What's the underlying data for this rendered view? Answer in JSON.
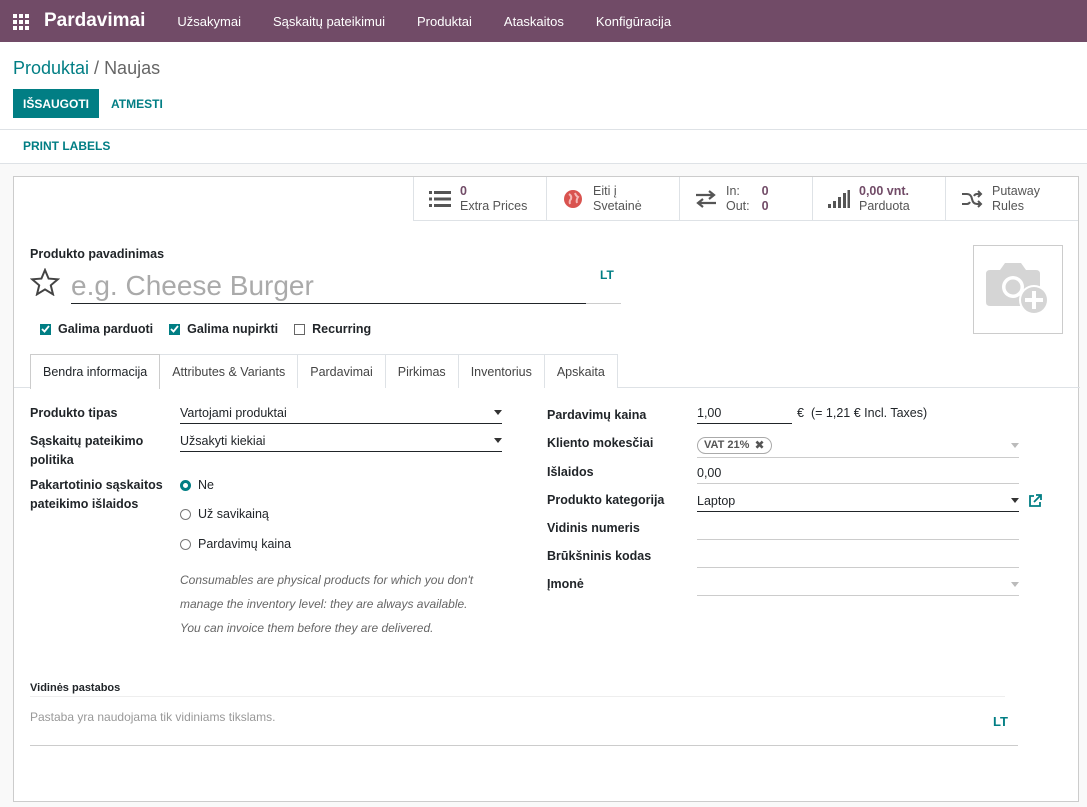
{
  "navbar": {
    "brand": "Pardavimai",
    "items": [
      "Užsakymai",
      "Sąskaitų pateikimui",
      "Produktai",
      "Ataskaitos",
      "Konfigūracija"
    ]
  },
  "breadcrumb": {
    "parent": "Produktai",
    "separator": " / ",
    "current": "Naujas"
  },
  "actions": {
    "save": "IŠSAUGOTI",
    "discard": "ATMESTI",
    "print": "PRINT LABELS"
  },
  "smart_buttons": {
    "extra_prices": {
      "value": "0",
      "label": "Extra Prices"
    },
    "website": {
      "line1": "Eiti į",
      "line2": "Svetainė"
    },
    "inout": {
      "in_label": "In:",
      "in_value": "0",
      "out_label": "Out:",
      "out_value": "0"
    },
    "sold": {
      "value": "0,00 vnt.",
      "label": "Parduota"
    },
    "putaway": {
      "line1": "Putaway",
      "line2": "Rules"
    }
  },
  "product": {
    "name_label": "Produkto pavadinimas",
    "name_placeholder": "e.g. Cheese Burger",
    "lang": "LT"
  },
  "checkboxes": [
    {
      "label": "Galima parduoti",
      "checked": true
    },
    {
      "label": "Galima nupirkti",
      "checked": true
    },
    {
      "label": "Recurring",
      "checked": false
    }
  ],
  "tabs": [
    "Bendra informacija",
    "Attributes & Variants",
    "Pardavimai",
    "Pirkimas",
    "Inventorius",
    "Apskaita"
  ],
  "left_fields": {
    "type_label": "Produkto tipas",
    "type_value": "Vartojami produktai",
    "policy_label_1": "Sąskaitų pateikimo",
    "policy_label_2": "politika",
    "policy_value": "Užsakyti kiekiai",
    "reinvoice_label_1": "Pakartotinio sąskaitos",
    "reinvoice_label_2": "pateikimo išlaidos",
    "radios": [
      {
        "label": "Ne",
        "selected": true
      },
      {
        "label": "Už savikainą",
        "selected": false
      },
      {
        "label": "Pardavimų kaina",
        "selected": false
      }
    ],
    "help_1": "Consumables are physical products for which you don't manage the inventory level: they are always available.",
    "help_2": "You can invoice them before they are delivered."
  },
  "right_fields": {
    "price_label": "Pardavimų kaina",
    "price_value": "1,00",
    "currency": "€",
    "incl_taxes": "(= 1,21 € Incl. Taxes)",
    "taxes_label": "Kliento mokesčiai",
    "tax_tag": "VAT 21%",
    "cost_label": "Išlaidos",
    "cost_value": "0,00",
    "category_label": "Produkto kategorija",
    "category_value": "Laptop",
    "ref_label": "Vidinis numeris",
    "barcode_label": "Brūkšninis kodas",
    "company_label": "Įmonė"
  },
  "notes": {
    "label": "Vidinės pastabos",
    "placeholder": "Pastaba yra naudojama tik vidiniams tikslams.",
    "lang": "LT"
  },
  "colors": {
    "brand": "#714b67",
    "accent": "#017e84"
  }
}
